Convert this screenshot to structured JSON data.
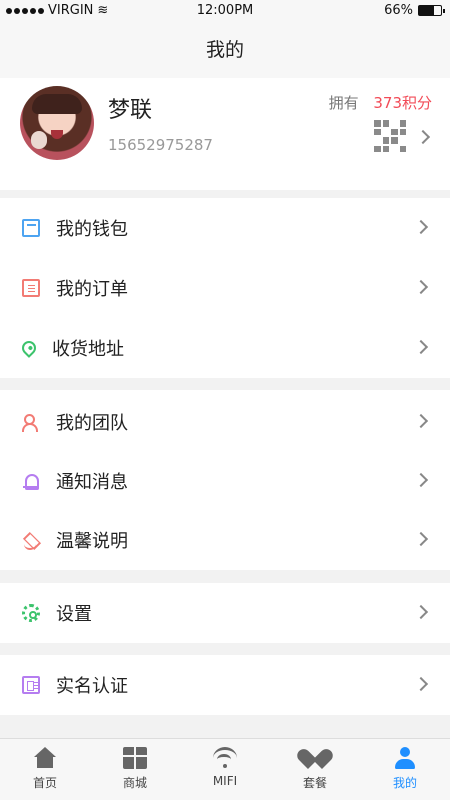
{
  "status_bar": {
    "carrier": "VIRGIN",
    "time": "12:00PM",
    "battery_percent": "66%",
    "battery_level": 0.66
  },
  "nav": {
    "title": "我的"
  },
  "profile": {
    "name": "梦联",
    "phone": "15652975287",
    "points_prefix": "拥有",
    "points_value": "373积分"
  },
  "menu": {
    "wallet": "我的钱包",
    "orders": "我的订单",
    "address": "收货地址",
    "team": "我的团队",
    "notifications": "通知消息",
    "notice": "温馨说明",
    "settings": "设置",
    "verification": "实名认证"
  },
  "tabbar": [
    {
      "label": "首页",
      "icon": "home-icon"
    },
    {
      "label": "商城",
      "icon": "gift-icon"
    },
    {
      "label": "MIFI",
      "icon": "wifi-icon"
    },
    {
      "label": "套餐",
      "icon": "heart-icon"
    },
    {
      "label": "我的",
      "icon": "person-icon",
      "active": true
    }
  ],
  "colors": {
    "accent": "#1f8fff",
    "points": "#f24b57",
    "background": "#f2f2f2"
  }
}
